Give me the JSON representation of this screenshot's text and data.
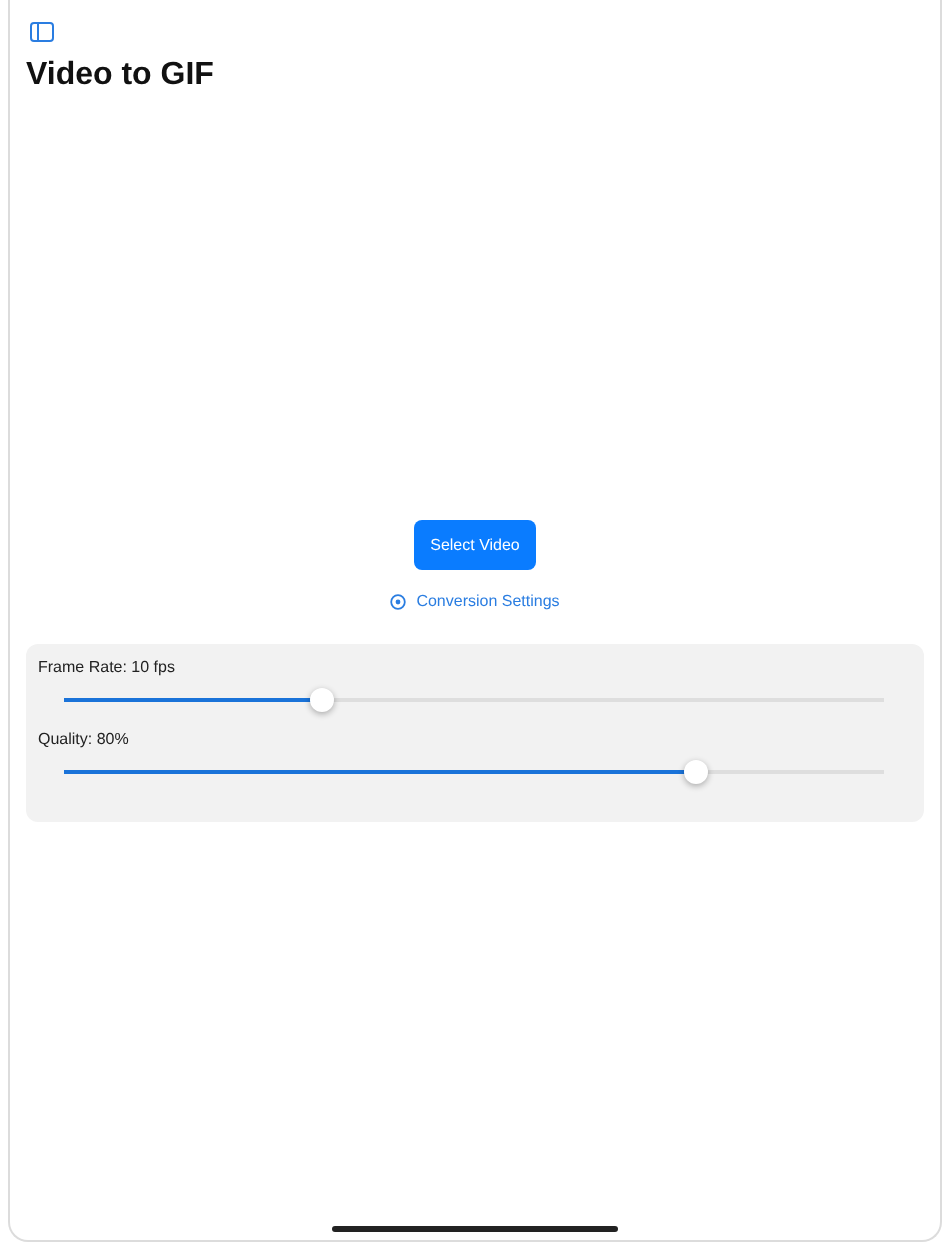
{
  "title": "Video to GIF",
  "select_button": "Select Video",
  "settings_link": "Conversion Settings",
  "sliders": [
    {
      "label": "Frame Rate: 10 fps",
      "level": 0.315
    },
    {
      "label": "Quality: 80%",
      "level": 0.77
    }
  ]
}
